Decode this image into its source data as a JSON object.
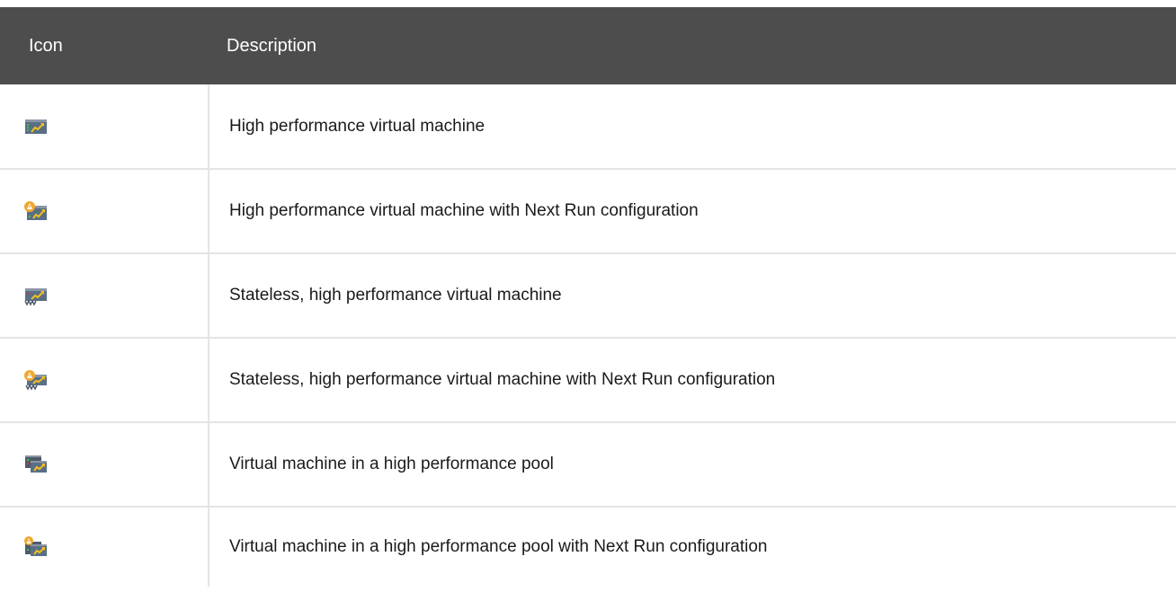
{
  "table": {
    "headers": {
      "icon": "Icon",
      "description": "Description"
    },
    "rows": [
      {
        "icon": "high-performance-vm-icon",
        "description": "High performance virtual machine"
      },
      {
        "icon": "high-performance-vm-next-run-icon",
        "description": "High performance virtual machine with Next Run configuration"
      },
      {
        "icon": "stateless-high-performance-vm-icon",
        "description": "Stateless, high performance virtual machine"
      },
      {
        "icon": "stateless-high-performance-vm-next-run-icon",
        "description": "Stateless, high performance virtual machine with Next Run configuration"
      },
      {
        "icon": "high-performance-pool-vm-icon",
        "description": "Virtual machine in a high performance pool"
      },
      {
        "icon": "high-performance-pool-vm-next-run-icon",
        "description": "Virtual machine in a high performance pool with Next Run configuration"
      }
    ]
  },
  "colors": {
    "header_bg": "#4d4d4d",
    "header_text": "#ffffff",
    "row_border": "#e4e4e4",
    "vm_body": "#5a6e86",
    "vm_top": "#8a96a6",
    "arrow": "#f0c020",
    "warning": "#f0a830",
    "led_green": "#3cc43c",
    "led_red": "#d83030"
  }
}
